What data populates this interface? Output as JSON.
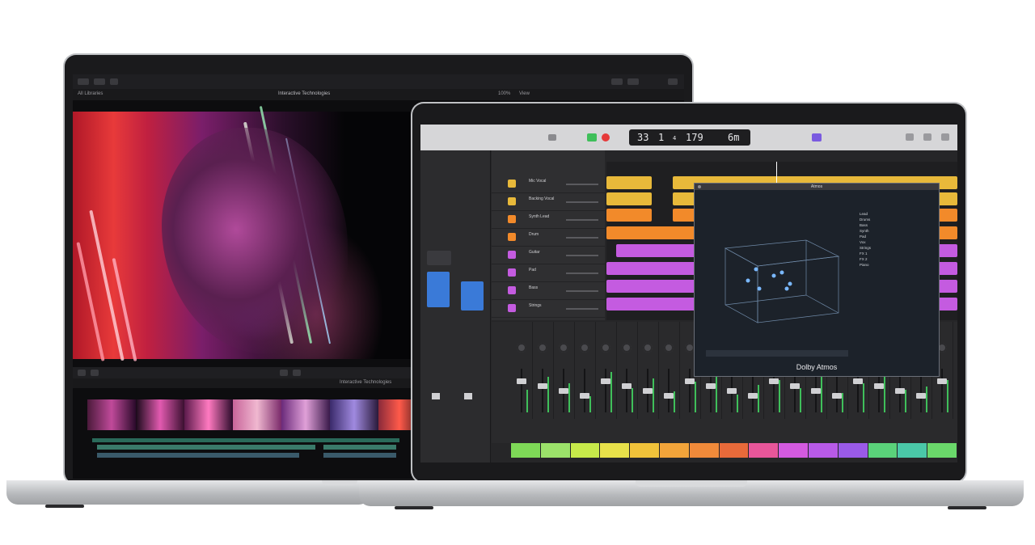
{
  "fcp": {
    "window_title": "Interactive Technologies",
    "library_label": "All Libraries",
    "zoom_label": "100%",
    "view_label": "View",
    "sidebar_label": "Interactive Technologies",
    "timeline_label": "Interactive Technologies"
  },
  "logic": {
    "lcd": {
      "bar": "33",
      "beat": "1",
      "div": "4",
      "tempo": "179",
      "key": "6m"
    },
    "tracks": [
      {
        "name": "Mic Vocal",
        "color": "#e8b93a"
      },
      {
        "name": "Backing Vocal",
        "color": "#e8b93a"
      },
      {
        "name": "Synth Lead",
        "color": "#f28a2a"
      },
      {
        "name": "Drum",
        "color": "#f28a2a"
      },
      {
        "name": "Guitar",
        "color": "#c45be0"
      },
      {
        "name": "Pad",
        "color": "#c45be0"
      },
      {
        "name": "Bass",
        "color": "#c45be0"
      },
      {
        "name": "Strings",
        "color": "#c45be0"
      }
    ],
    "atmos": {
      "title": "Atmos",
      "brand": "Dolby Atmos",
      "objects": [
        "Lead",
        "Drums",
        "Bass",
        "Synth",
        "Pad",
        "Vox",
        "Strings",
        "FX 1",
        "FX 2",
        "Piano"
      ]
    },
    "channel_colors": [
      "#7ed957",
      "#9be26a",
      "#c7ea4a",
      "#e8e14a",
      "#f0c23a",
      "#f2a43a",
      "#f08a3a",
      "#e86a3a",
      "#e8569a",
      "#d45ae0",
      "#b85ae8",
      "#9a5ae8",
      "#5ad27a",
      "#4ac8a8",
      "#6ad86a"
    ]
  }
}
